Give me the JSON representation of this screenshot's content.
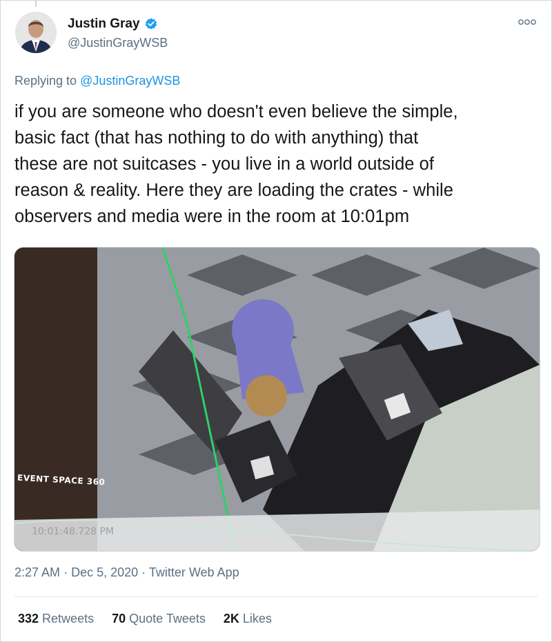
{
  "tweet": {
    "display_name": "Justin Gray",
    "handle": "@JustinGrayWSB",
    "verified_icon": "verified-badge-icon",
    "replying_prefix": "Replying to",
    "replying_to": "@JustinGrayWSB",
    "text_lines": [
      "if you are someone who doesn't even believe the simple,",
      "basic fact (that has nothing to do with anything) that",
      "these are not suitcases - you live in a world outside of",
      "reason & reality. Here they are loading the crates - while",
      "observers and media were in the room at 10:01pm"
    ],
    "media": {
      "overlay_label": "EVENT SPACE 360",
      "timestamp_overlay": "10:01:48.728 PM"
    },
    "time": "2:27 AM",
    "date": "Dec 5, 2020",
    "separator": "·",
    "source": "Twitter Web App",
    "stats": {
      "retweets_count": "332",
      "retweets_label": "Retweets",
      "quotes_count": "70",
      "quotes_label": "Quote Tweets",
      "likes_count": "2K",
      "likes_label": "Likes"
    }
  },
  "colors": {
    "link": "#1b95e0",
    "muted": "#5b7083",
    "text": "#14171a",
    "verified": "#1da1f2"
  }
}
